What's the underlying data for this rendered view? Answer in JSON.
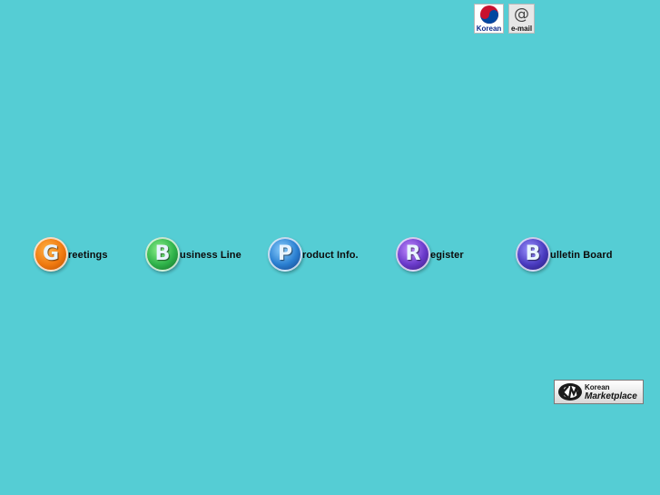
{
  "top": {
    "korean_label": "Korean",
    "email_label": "e-mail",
    "email_symbol": "@"
  },
  "nav": [
    {
      "initial": "G",
      "rest": "reetings"
    },
    {
      "initial": "B",
      "rest": "usiness Line"
    },
    {
      "initial": "P",
      "rest": "roduct Info."
    },
    {
      "initial": "R",
      "rest": "egister"
    },
    {
      "initial": "B",
      "rest": "ulletin Board"
    }
  ],
  "banner": {
    "line1": "Korean",
    "line2": "Marketplace"
  },
  "colors": {
    "background": "#55cdd4"
  }
}
